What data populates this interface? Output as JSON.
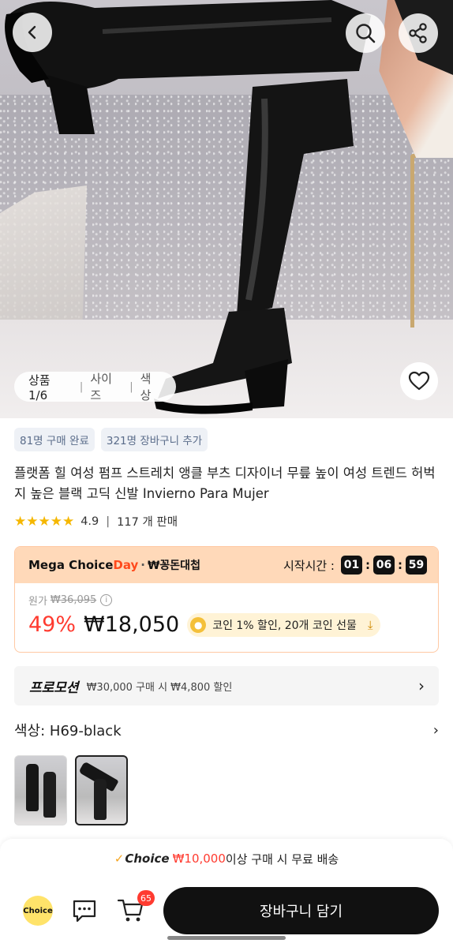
{
  "image_tabs": {
    "product": "상품 1/6",
    "size": "사이즈",
    "color": "색상"
  },
  "badges": [
    "81명 구매 완료",
    "321명 장바구니 추가"
  ],
  "title": "플랫폼 힐 여성 펌프 스트레치 앵클 부츠 디자이너 무릎 높이 여성 트렌드 허벅지 높은 블랙 고딕 신발 Invierno Para Mujer",
  "rating": {
    "stars": "★★★★★",
    "score": "4.9",
    "sold": "117 개 판매"
  },
  "mega": {
    "brand_a": "Mega Choice",
    "brand_b": "Day",
    "brand_dot": "·",
    "brand_sub": "₩꽁돈대첩",
    "timer_label": "시작시간 :",
    "hours": "01",
    "minutes": "06",
    "seconds": "59",
    "orig_label": "원가",
    "orig_price": "₩36,095",
    "discount": "49%",
    "price": "₩18,050",
    "coin_text": "코인 1% 할인, 20개 코인 선물"
  },
  "promo": {
    "title": "프로모션",
    "text": "₩30,000 구매 시 ₩4,800 할인"
  },
  "color": {
    "label": "색상: H69-black"
  },
  "shipping": {
    "choice": "Choice",
    "amount": "₩10,000",
    "text": "이상 구매 시 무료 배송"
  },
  "bottom": {
    "choice_label": "Choice",
    "cart_count": "65",
    "add_to_cart": "장바구니 담기"
  },
  "colors": {
    "accent_red": "#ff3b30",
    "mega_bg": "#ffd9b9",
    "choice_yellow": "#ffe36a"
  }
}
